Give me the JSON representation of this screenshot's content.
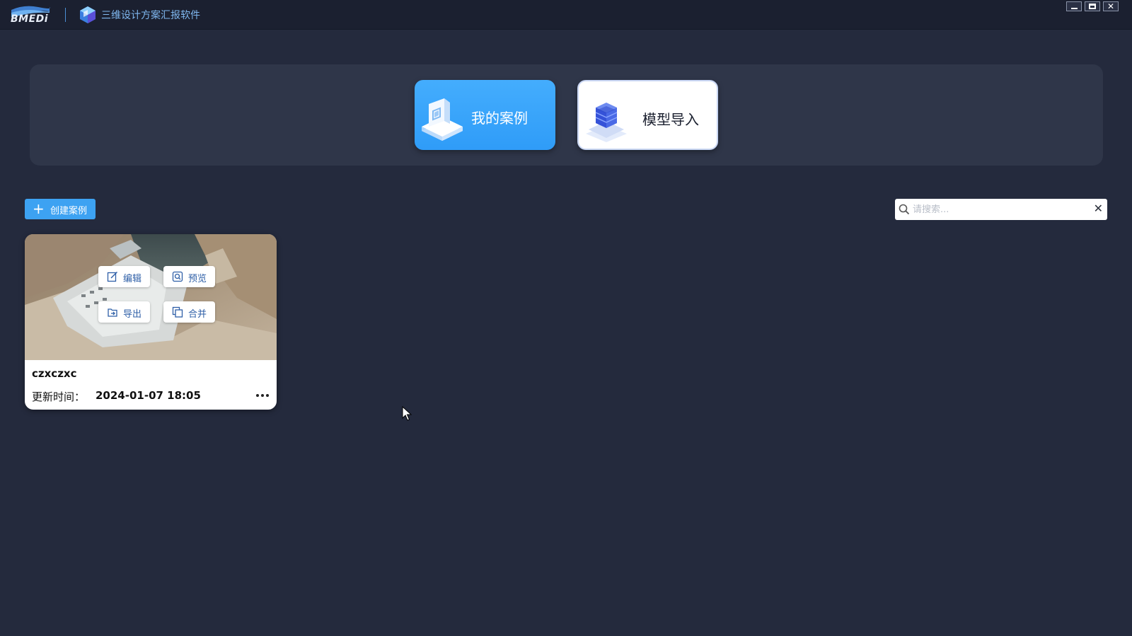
{
  "titlebar": {
    "brand": "BMEDi",
    "app_title": "三维设计方案汇报软件",
    "window_controls": [
      "minimize",
      "maximize",
      "close"
    ]
  },
  "nav": {
    "my_cases": {
      "label": "我的案例",
      "active": true
    },
    "model_import": {
      "label": "模型导入",
      "active": false
    }
  },
  "toolbar": {
    "create_label": "创建案例",
    "search": {
      "placeholder": "请搜索...",
      "value": ""
    }
  },
  "cases": [
    {
      "name": "czxczxc",
      "updated_label": "更新时间：",
      "updated_value": "2024-01-07 18:05",
      "actions": {
        "edit": "编辑",
        "preview": "预览",
        "export": "导出",
        "merge": "合并"
      }
    }
  ],
  "colors": {
    "background": "#242a3d",
    "titlebar": "#1b2030",
    "panel": "#2f3649",
    "accent": "#3da2f2",
    "action_text": "#2e5fa7"
  }
}
